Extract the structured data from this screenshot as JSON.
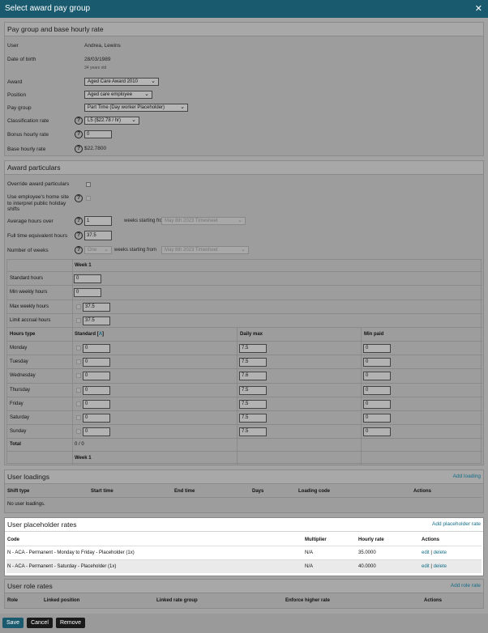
{
  "dialog": {
    "title": "Select award pay group"
  },
  "pay_group": {
    "title": "Pay group and base hourly rate",
    "labels": {
      "user": "User",
      "dob": "Date of birth",
      "award": "Award",
      "position": "Position",
      "pay_group": "Pay group",
      "classification": "Classification rate",
      "bonus": "Bonus hourly rate",
      "base": "Base hourly rate"
    },
    "user": "Andrea, Lewins",
    "dob": "28/03/1989",
    "age": "34 years old",
    "award": "Aged Care Award 2010",
    "position": "Aged care employee",
    "pay_group": "Part Time (Day worker Placeholder)",
    "classification": "L5 ($22.78 / hr)",
    "bonus": "0",
    "base": "$22.7800"
  },
  "award_particulars": {
    "title": "Award particulars",
    "labels": {
      "override": "Override award particulars",
      "home_site": "Use employee's home site to interpret public holiday shifts",
      "avg_hours": "Average hours over",
      "fte": "Full time equivalent hours",
      "num_weeks": "Number of weeks"
    },
    "avg_hours_value": "1",
    "weeks_starting_from": "weeks starting from",
    "avg_timesheet": "May 8th 2023 Timesheet",
    "fte_value": "37.5",
    "num_weeks_value": "One",
    "num_weeks_timesheet": "May 8th 2023 Timesheet",
    "week_header": "Week 1",
    "hour_rows": [
      {
        "label": "Standard hours",
        "value": "0"
      },
      {
        "label": "Min weekly hours",
        "value": "0"
      },
      {
        "label": "Max weekly hours",
        "value": "37.5"
      },
      {
        "label": "Limit accrual hours",
        "value": "37.5"
      }
    ],
    "days_header": {
      "type": "Hours type",
      "standard": "Standard",
      "standard_badge": "A",
      "daily_max": "Daily max",
      "min_paid": "Min paid"
    },
    "days": [
      {
        "day": "Monday",
        "standard": "0",
        "daily_max": "7.5",
        "min_paid": "0"
      },
      {
        "day": "Tuesday",
        "standard": "0",
        "daily_max": "7.5",
        "min_paid": "0"
      },
      {
        "day": "Wednesday",
        "standard": "0",
        "daily_max": "7.6",
        "min_paid": "0"
      },
      {
        "day": "Thursday",
        "standard": "0",
        "daily_max": "7.5",
        "min_paid": "0"
      },
      {
        "day": "Friday",
        "standard": "0",
        "daily_max": "7.5",
        "min_paid": "0"
      },
      {
        "day": "Saturday",
        "standard": "0",
        "daily_max": "7.5",
        "min_paid": "0"
      },
      {
        "day": "Sunday",
        "standard": "0",
        "daily_max": "7.5",
        "min_paid": "0"
      }
    ],
    "total_label": "Total",
    "total_value": "0 / 0",
    "footer_week": "Week 1"
  },
  "user_loadings": {
    "title": "User loadings",
    "add_link": "Add loading",
    "columns": [
      "Shift type",
      "Start time",
      "End time",
      "Days",
      "Loading code",
      "Actions"
    ],
    "empty": "No user loadings."
  },
  "placeholder_rates": {
    "title": "User placeholder rates",
    "add_link": "Add placeholder rate",
    "columns": [
      "Code",
      "Multiplier",
      "Hourly rate",
      "Actions"
    ],
    "rows": [
      {
        "code": "N - ACA - Permanent - Monday to Friday - Placeholder (1x)",
        "multiplier": "N/A",
        "rate": "35.0000",
        "edit": "edit",
        "delete": "delete"
      },
      {
        "code": "N - ACA - Permanent - Saturday - Placeholder (1x)",
        "multiplier": "N/A",
        "rate": "40.0000",
        "edit": "edit",
        "delete": "delete"
      }
    ]
  },
  "role_rates": {
    "title": "User role rates",
    "add_link": "Add role rate",
    "columns": [
      "Role",
      "Linked position",
      "Linked rate group",
      "Enforce higher rate",
      "Actions"
    ]
  },
  "footer": {
    "save": "Save",
    "cancel": "Cancel",
    "remove": "Remove"
  }
}
